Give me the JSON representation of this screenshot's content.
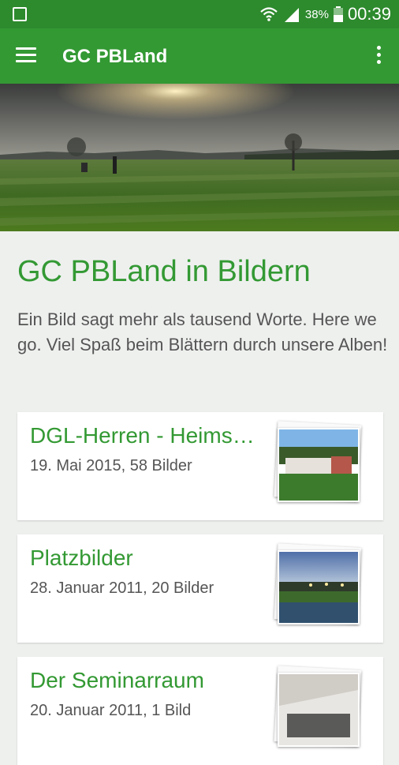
{
  "status_bar": {
    "battery": "38%",
    "time": "00:39"
  },
  "app_bar": {
    "title": "GC PBLand"
  },
  "page": {
    "title": "GC PBLand in Bildern",
    "intro": "Ein Bild sagt mehr als tausend Worte. Here we go. Viel Spaß beim Blättern durch unsere Alben!"
  },
  "albums": [
    {
      "title": "DGL-Herren - Heimspiel",
      "meta": "19. Mai 2015, 58 Bilder"
    },
    {
      "title": "Platzbilder",
      "meta": "28. Januar 2011, 20 Bilder"
    },
    {
      "title": "Der Seminarraum",
      "meta": "20. Januar 2011, 1 Bild"
    }
  ],
  "colors": {
    "primary": "#339933",
    "primary_dark": "#2d8a2d",
    "background": "#eef0ee"
  }
}
